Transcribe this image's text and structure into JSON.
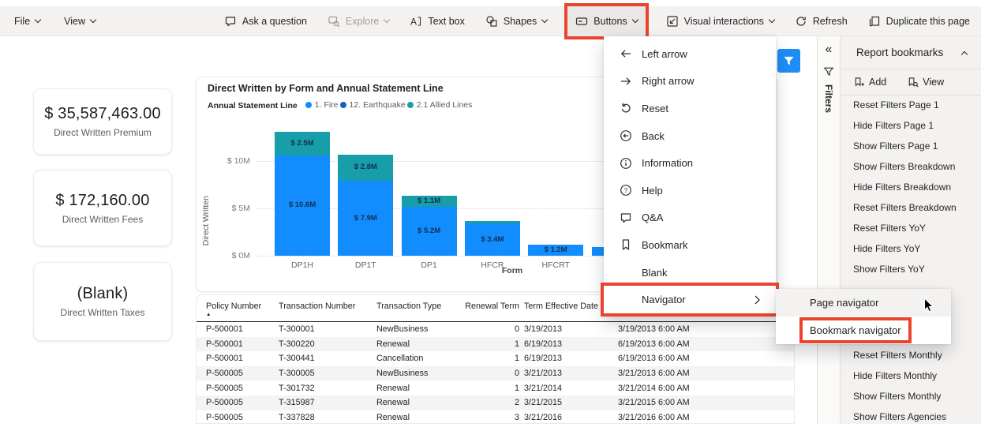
{
  "toolbar": {
    "file_label": "File",
    "view_label": "View",
    "ask_question_label": "Ask a question",
    "explore_label": "Explore",
    "text_box_label": "Text box",
    "shapes_label": "Shapes",
    "buttons_label": "Buttons",
    "visual_interactions_label": "Visual interactions",
    "refresh_label": "Refresh",
    "duplicate_label": "Duplicate this page"
  },
  "buttons_menu": {
    "items": [
      {
        "label": "Left arrow",
        "icon": "left-arrow"
      },
      {
        "label": "Right arrow",
        "icon": "right-arrow"
      },
      {
        "label": "Reset",
        "icon": "reset"
      },
      {
        "label": "Back",
        "icon": "back"
      },
      {
        "label": "Information",
        "icon": "information"
      },
      {
        "label": "Help",
        "icon": "help"
      },
      {
        "label": "Q&A",
        "icon": "qa"
      },
      {
        "label": "Bookmark",
        "icon": "bookmark"
      },
      {
        "label": "Blank",
        "icon": null
      },
      {
        "label": "Navigator",
        "icon": null,
        "has_submenu": true,
        "highlighted": true
      }
    ],
    "submenu": [
      {
        "label": "Page navigator",
        "hovered": true
      },
      {
        "label": "Bookmark navigator",
        "highlighted": true
      }
    ]
  },
  "kpis": [
    {
      "value": "$ 35,587,463.00",
      "label": "Direct Written Premium"
    },
    {
      "value": "$ 172,160.00",
      "label": "Direct Written Fees"
    },
    {
      "value": "(Blank)",
      "label": "Direct Written Taxes"
    }
  ],
  "chart_data": {
    "type": "bar",
    "stacked": true,
    "title": "Direct Written by Form and Annual Statement Line",
    "legend_title": "Annual Statement Line",
    "legend": [
      {
        "name": "1. Fire",
        "color": "#118DFF"
      },
      {
        "name": "12. Earthquake",
        "color": "#1264C0"
      },
      {
        "name": "2.1 Allied Lines",
        "color": "#179EA8"
      }
    ],
    "categories": [
      "DP1H",
      "DP1T",
      "DP1",
      "HFCR",
      "HFCRT"
    ],
    "series": [
      {
        "name": "1. Fire",
        "color": "#118DFF",
        "values": [
          10.6,
          7.9,
          5.2,
          3.4,
          1.2
        ],
        "labels": [
          "$ 10.6M",
          "$ 7.9M",
          "$ 5.2M",
          "$ 3.4M",
          "$ 1.2M"
        ]
      },
      {
        "name": "2.1 Allied Lines",
        "color": "#179EA8",
        "values": [
          2.5,
          2.8,
          1.1,
          0.3,
          0
        ],
        "labels": [
          "$ 2.5M",
          "$ 2.8M",
          "$ 1.1M",
          "",
          ""
        ]
      }
    ],
    "partial_bar_value": 0.9,
    "xlabel": "Form",
    "ylabel": "Direct Written",
    "ylim": [
      0,
      13.5
    ],
    "units": "millions USD",
    "yticks": [
      {
        "value": 0,
        "label": "$ 0M"
      },
      {
        "value": 5,
        "label": "$ 5M"
      },
      {
        "value": 10,
        "label": "$ 10M"
      }
    ]
  },
  "table": {
    "columns": [
      {
        "label": "Policy Number",
        "align": "left",
        "sorted": "asc"
      },
      {
        "label": "Transaction Number",
        "align": "left"
      },
      {
        "label": "Transaction Type",
        "align": "left"
      },
      {
        "label": "Renewal Term",
        "align": "right"
      },
      {
        "label": "Term Effective Date",
        "align": "left"
      },
      {
        "label": "",
        "align": "left"
      }
    ],
    "rows": [
      [
        "P-500001",
        "T-300001",
        "NewBusiness",
        "0",
        "3/19/2013",
        "3/19/2013 6:00 AM"
      ],
      [
        "P-500001",
        "T-300220",
        "Renewal",
        "1",
        "6/19/2013",
        "6/19/2013 6:00 AM"
      ],
      [
        "P-500001",
        "T-300441",
        "Cancellation",
        "1",
        "6/19/2013",
        "6/19/2013 6:00 AM"
      ],
      [
        "P-500005",
        "T-300005",
        "NewBusiness",
        "0",
        "3/21/2013",
        "3/21/2013 6:00 AM"
      ],
      [
        "P-500005",
        "T-301732",
        "Renewal",
        "1",
        "3/21/2014",
        "3/21/2014 6:00 AM"
      ],
      [
        "P-500005",
        "T-315987",
        "Renewal",
        "2",
        "3/21/2015",
        "3/21/2015 6:00 AM"
      ],
      [
        "P-500005",
        "T-337828",
        "Renewal",
        "3",
        "3/21/2016",
        "3/21/2016 6:00 AM"
      ]
    ]
  },
  "filters_rail": {
    "collapse_glyph": "«",
    "label": "Filters"
  },
  "bookmarks_pane": {
    "title": "Report bookmarks",
    "add_label": "Add",
    "view_label": "View",
    "items_top": [
      "Reset Filters Page 1",
      "Hide Filters Page 1",
      "Show Filters Page 1",
      "Show Filters Breakdown",
      "Hide Filters Breakdown",
      "Reset Filters Breakdown",
      "Reset Filters YoY",
      "Hide Filters YoY",
      "Show Filters YoY"
    ],
    "items_bottom": [
      "Reset Filters Monthly",
      "Hide Filters Monthly",
      "Show Filters Monthly",
      "Show Filters Agencies"
    ]
  },
  "colors": {
    "highlight_red": "#E8442E",
    "fire_blue": "#118DFF",
    "allied_teal": "#179EA8",
    "earthquake_blue": "#1264C0",
    "filter_pill_blue": "#1E8EF7"
  }
}
